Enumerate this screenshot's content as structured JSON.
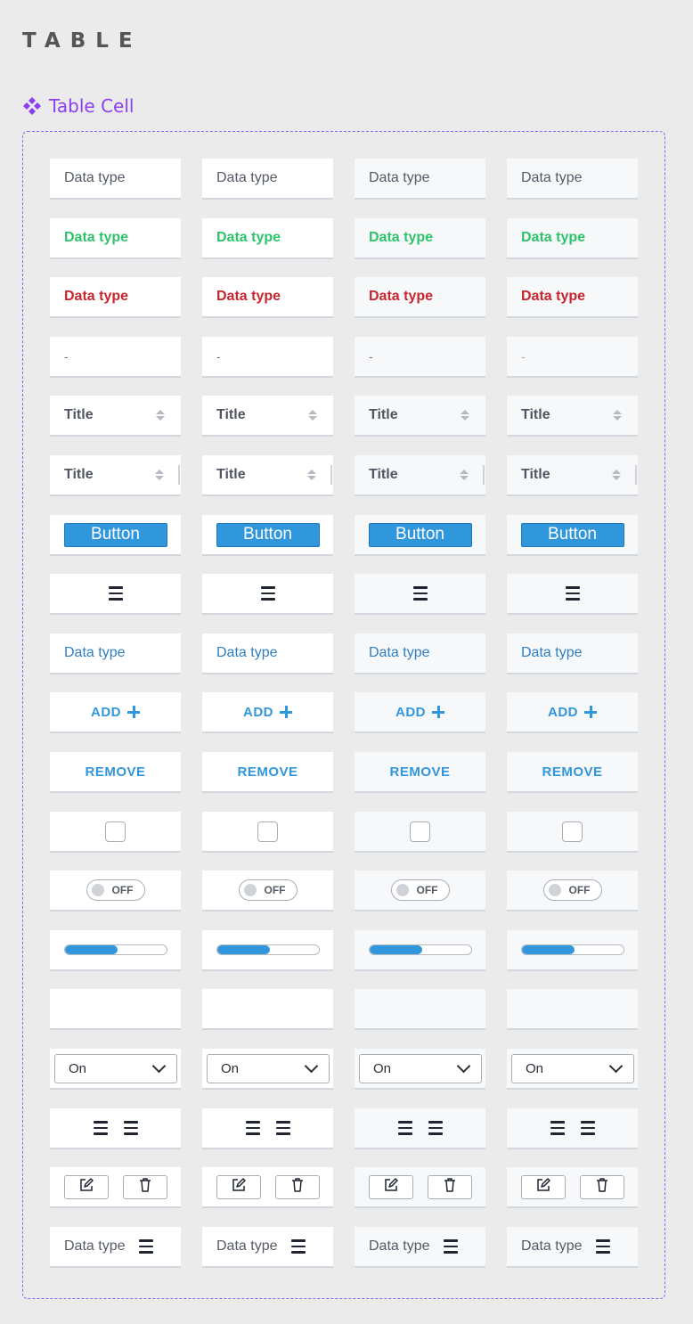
{
  "page": {
    "title": "TABLE",
    "frame_label": "Table Cell"
  },
  "cells": {
    "data_type": "Data type",
    "dash": "-",
    "title": "Title",
    "button": "Button",
    "add": "ADD",
    "remove": "REMOVE",
    "toggle_off": "OFF",
    "select_value": "On",
    "progress_fraction": 0.52
  },
  "colors": {
    "accent": "#3197dc",
    "success": "#2ec36a",
    "danger": "#c8262e",
    "frame": "#8b63f2",
    "label": "#8a3ff0"
  },
  "icons": {
    "component": "component-diamond-icon",
    "sort": "sort-arrows-icon",
    "menu": "hamburger-menu-icon",
    "plus": "plus-icon",
    "edit": "edit-pencil-icon",
    "delete": "trash-icon",
    "chevron": "chevron-down-icon"
  }
}
